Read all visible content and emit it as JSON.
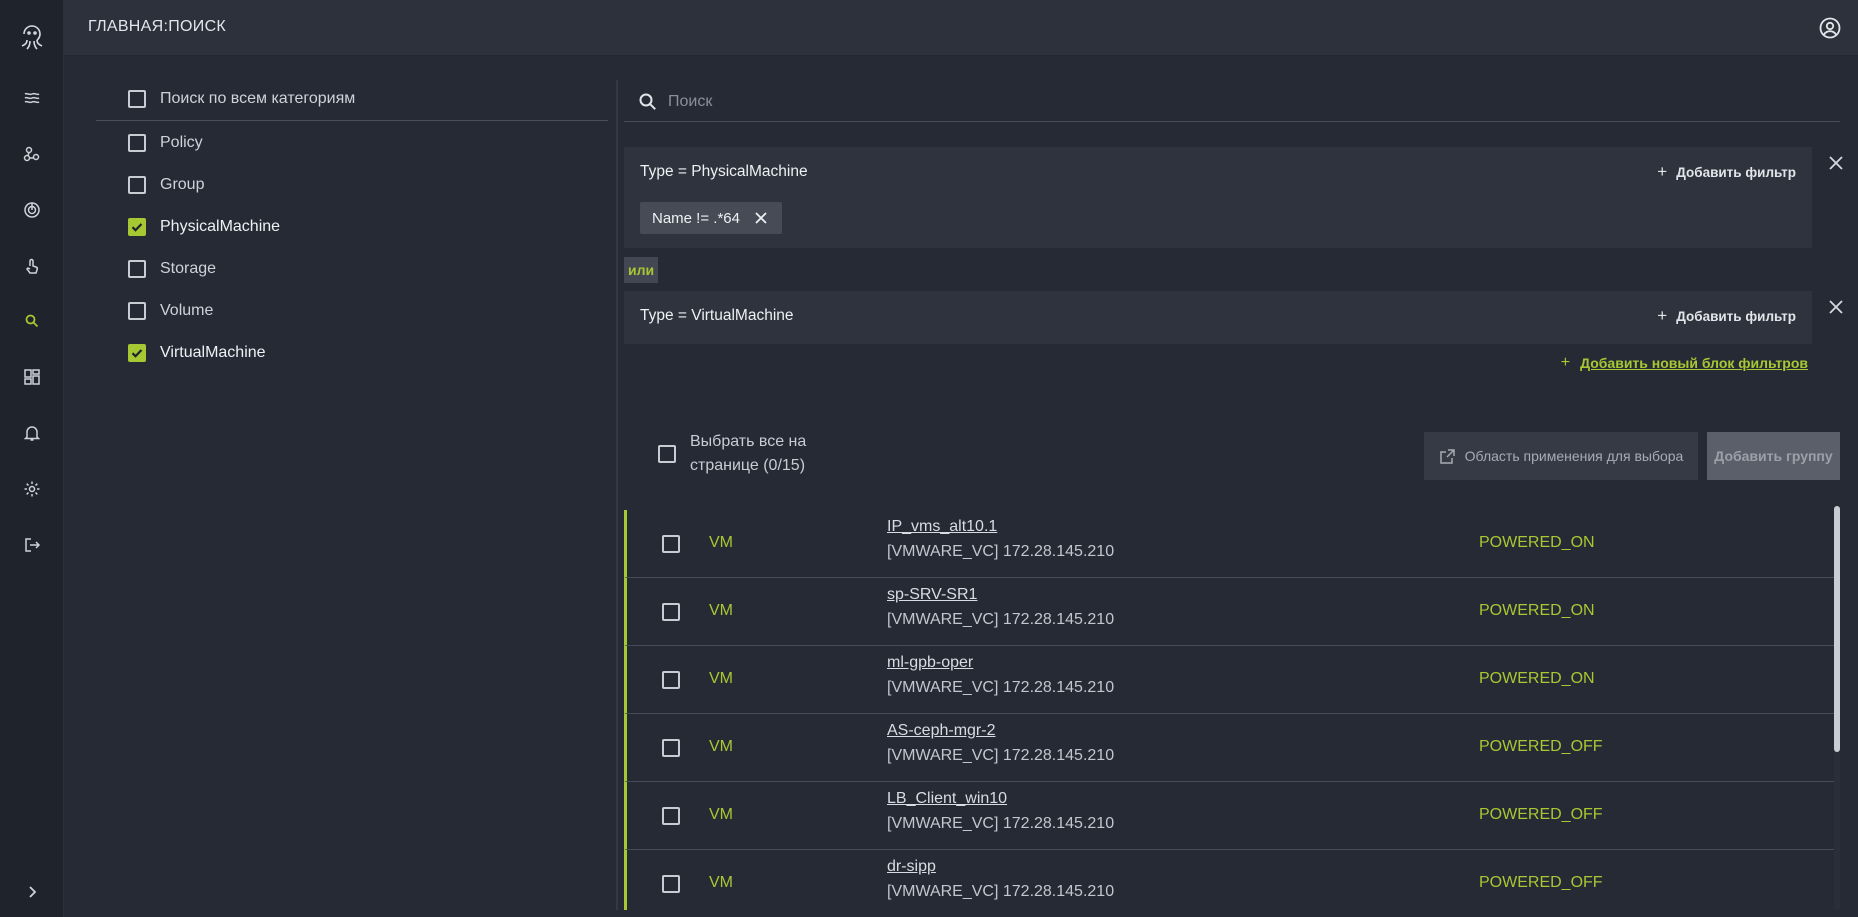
{
  "header": {
    "title": "ГЛАВНАЯ:ПОИСК",
    "account_icon": "account-circle-icon"
  },
  "rail": {
    "logo_icon": "octopus-logo-icon",
    "items": [
      {
        "icon": "layers-icon"
      },
      {
        "icon": "topology-icon"
      },
      {
        "icon": "monitoring-icon"
      },
      {
        "icon": "touch-icon"
      },
      {
        "icon": "search-icon",
        "active": true
      },
      {
        "icon": "dashboard-icon"
      },
      {
        "icon": "bell-icon"
      },
      {
        "icon": "gear-icon"
      },
      {
        "icon": "logout-icon"
      }
    ],
    "expand_icon": "chevron-right-icon"
  },
  "categories": {
    "all_label": "Поиск по всем категориям",
    "items": [
      {
        "label": "Policy",
        "checked": false
      },
      {
        "label": "Group",
        "checked": false
      },
      {
        "label": "PhysicalMachine",
        "checked": true
      },
      {
        "label": "Storage",
        "checked": false
      },
      {
        "label": "Volume",
        "checked": false
      },
      {
        "label": "VirtualMachine",
        "checked": true
      }
    ]
  },
  "search": {
    "placeholder": "Поиск",
    "value": ""
  },
  "filters": {
    "blocks": [
      {
        "title": "Type = PhysicalMachine",
        "add_label": "Добавить фильтр",
        "chips": [
          "Name != .*64"
        ]
      },
      {
        "title": "Type = VirtualMachine",
        "add_label": "Добавить фильтр",
        "chips": []
      }
    ],
    "or_label": "или",
    "add_block_label": "Добавить новый блок фильтров"
  },
  "selection": {
    "select_all_label": "Выбрать все на странице (0/15)",
    "scope_button": "Область применения для выбора",
    "add_group_button": "Добавить группу"
  },
  "results": [
    {
      "kind": "VM",
      "name": "IP_vms_alt10.1",
      "source": "[VMWARE_VC] 172.28.145.210",
      "state": "POWERED_ON"
    },
    {
      "kind": "VM",
      "name": "sp-SRV-SR1",
      "source": "[VMWARE_VC] 172.28.145.210",
      "state": "POWERED_ON"
    },
    {
      "kind": "VM",
      "name": "ml-gpb-oper",
      "source": "[VMWARE_VC] 172.28.145.210",
      "state": "POWERED_ON"
    },
    {
      "kind": "VM",
      "name": "AS-ceph-mgr-2",
      "source": "[VMWARE_VC] 172.28.145.210",
      "state": "POWERED_OFF"
    },
    {
      "kind": "VM",
      "name": "LB_Client_win10",
      "source": "[VMWARE_VC] 172.28.145.210",
      "state": "POWERED_OFF"
    },
    {
      "kind": "VM",
      "name": "dr-sipp",
      "source": "[VMWARE_VC] 172.28.145.210",
      "state": "POWERED_OFF"
    }
  ],
  "colors": {
    "accent": "#a6c832",
    "background": "#262a35",
    "rail": "#1f232c",
    "topbar": "#2d313b"
  }
}
